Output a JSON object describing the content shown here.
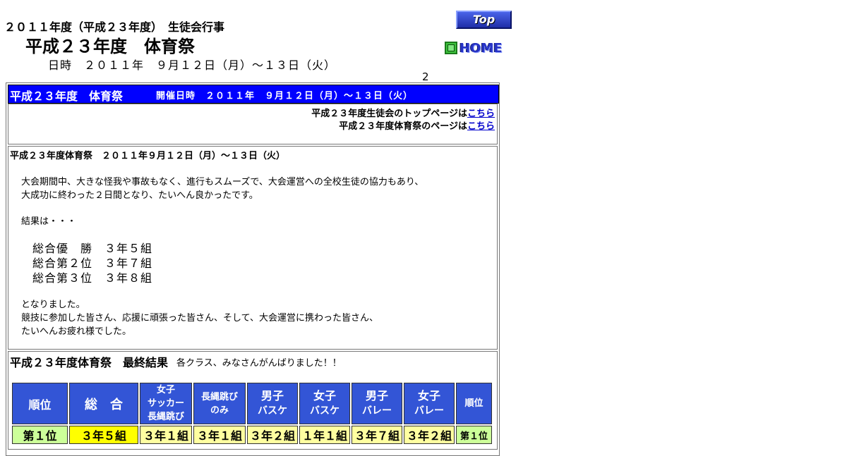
{
  "header": {
    "supertitle": "２０１１年度（平成２３年度）　生徒会行事",
    "title": "平成２３年度　体育祭",
    "date_line": "日時　２０１１年　９月１２日（月）～１３日（火）",
    "counter": "2"
  },
  "nav": {
    "top_label": "Top",
    "home_label": "HOME"
  },
  "banner": {
    "title": "平成２３年度　体育祭",
    "date": "開催日時　２０１１年　９月１２日（月）～１３日（火）"
  },
  "links": [
    {
      "text": "平成２３年度生徒会のトップページは",
      "link": "こちら"
    },
    {
      "text": "平成２３年度体育祭のページは",
      "link": "こちら"
    }
  ],
  "summary": {
    "heading": "平成２３年度体育祭　２０１１年９月１２日（月）～１３日（火）",
    "para1_line1": "大会期間中、大きな怪我や事故もなく、進行もスムーズで、大会運営への全校生徒の協力もあり、",
    "para1_line2": "大成功に終わった２日間となり、たいへん良かったです。",
    "results_intro": "結果は・・・",
    "ranks": [
      "総合優　勝　３年５組",
      "総合第２位　３年７組",
      "総合第３位　３年８組"
    ],
    "outro_line1": "となりました。",
    "outro_line2": "競技に参加した皆さん、応援に頑張った皆さん、そして、大会運営に携わった皆さん、",
    "outro_line3": "たいへんお疲れ様でした。"
  },
  "results": {
    "title": "平成２３年度体育祭　最終結果",
    "note": "各クラス、みなさんがんばりました！！",
    "columns": [
      {
        "l1": "順位"
      },
      {
        "l1": "総　合"
      },
      {
        "l1": "女子",
        "l2": "サッカー",
        "l3": "長縄跳び"
      },
      {
        "l1": "長縄跳び",
        "l2": "のみ"
      },
      {
        "l1": "男子",
        "l2": "バスケ"
      },
      {
        "l1": "女子",
        "l2": "バスケ"
      },
      {
        "l1": "男子",
        "l2": "バレー"
      },
      {
        "l1": "女子",
        "l2": "バレー"
      },
      {
        "l1": "順位"
      }
    ],
    "rows": [
      {
        "cells": [
          "第１位",
          "３年５組",
          "３年１組",
          "３年１組",
          "３年２組",
          "１年１組",
          "３年７組",
          "３年２組",
          "第１位"
        ]
      }
    ]
  },
  "colors": {
    "banner": "#0000ff",
    "header_cell": "#3355d6",
    "rank_cell": "#ccff99",
    "total_cell": "#ffff00",
    "data_cell": "#ffffa0",
    "link": "#0000cc"
  }
}
